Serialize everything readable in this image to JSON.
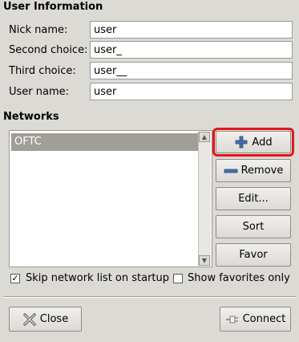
{
  "user_info": {
    "title": "User Information",
    "nick": {
      "label": "Nick name:",
      "value": "user"
    },
    "second": {
      "label": "Second choice:",
      "value": "user_"
    },
    "third": {
      "label": "Third choice:",
      "value": "user__"
    },
    "username": {
      "label": "User name:",
      "value": "user"
    }
  },
  "networks": {
    "title": "Networks",
    "items": [
      "OFTC"
    ],
    "selected": "OFTC"
  },
  "buttons": {
    "add": "Add",
    "remove": "Remove",
    "edit": "Edit...",
    "sort": "Sort",
    "favor": "Favor"
  },
  "options": {
    "skip_label": "Skip network list on startup",
    "skip_checked": true,
    "favorites_label": "Show favorites only",
    "favorites_checked": false
  },
  "footer": {
    "close": "Close",
    "connect": "Connect"
  },
  "colors": {
    "highlight": "#e8141c",
    "selection": "#a19e97",
    "background": "#dcdad5"
  }
}
